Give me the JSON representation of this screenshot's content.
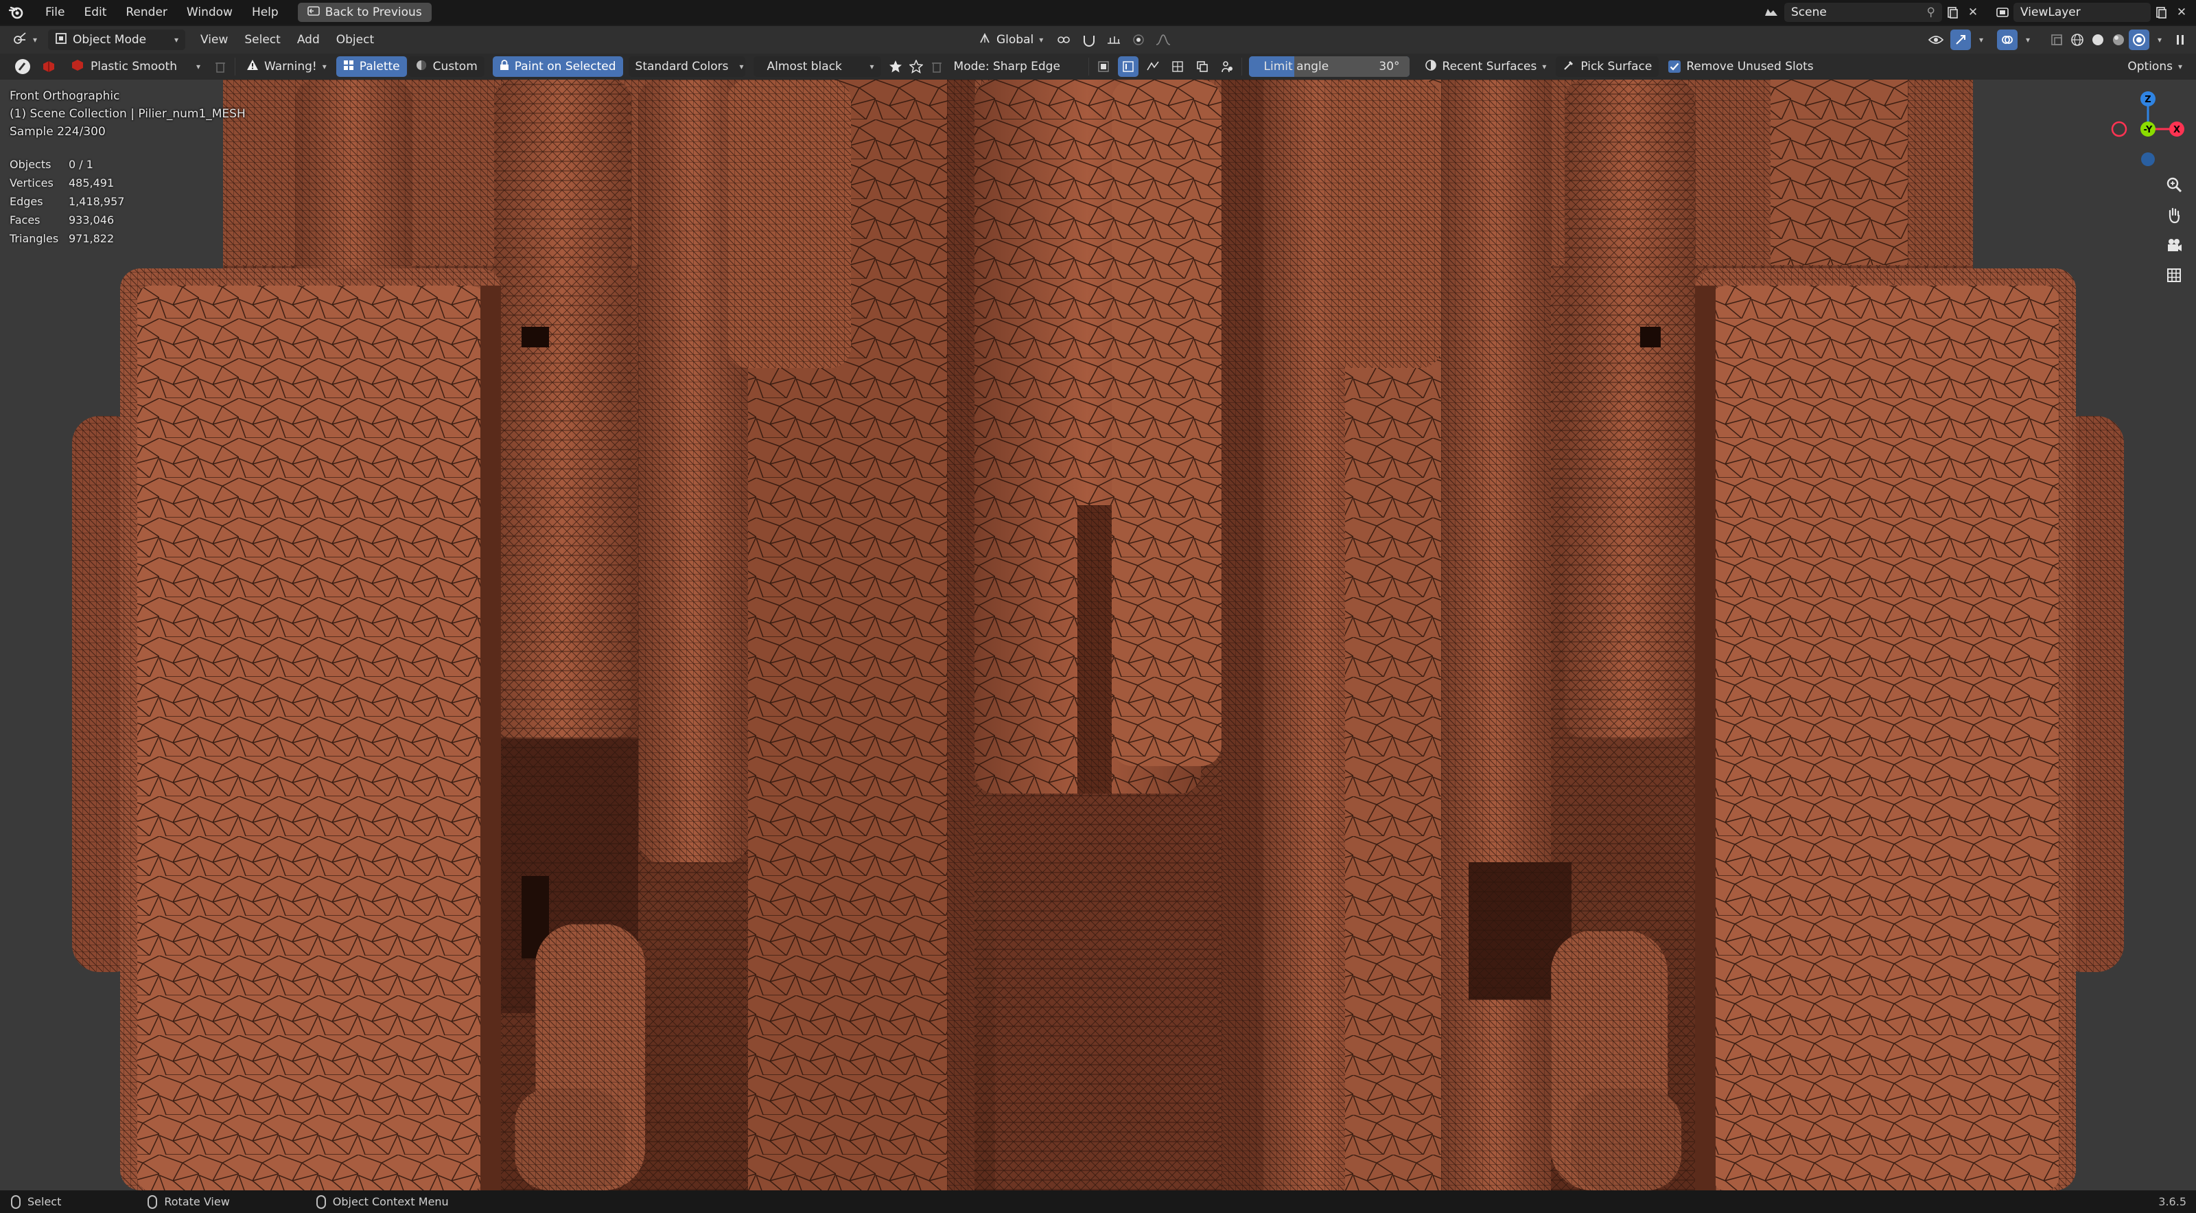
{
  "topbar": {
    "menus": [
      "File",
      "Edit",
      "Render",
      "Window",
      "Help"
    ],
    "back_label": "Back to Previous",
    "scene": "Scene",
    "view_layer": "ViewLayer"
  },
  "header": {
    "mode": "Object Mode",
    "menus": [
      "View",
      "Select",
      "Add",
      "Object"
    ],
    "transform_orientation": "Global"
  },
  "tool": {
    "brush": "Plastic Smooth",
    "warning": "Warning!",
    "palette": "Palette",
    "custom": "Custom",
    "paint_on_selected": "Paint on Selected",
    "color_set": "Standard Colors",
    "color": "Almost black",
    "mode": "Mode: Sharp Edge",
    "limit_angle_label": "Limit angle",
    "limit_angle_value": "30°",
    "recent_surfaces": "Recent Surfaces",
    "pick_surface": "Pick Surface",
    "remove_unused": "Remove Unused Slots",
    "options": "Options"
  },
  "viewport": {
    "view_name": "Front Orthographic",
    "collection": "(1) Scene Collection | Pilier_num1_MESH",
    "sample": "Sample 224/300",
    "stats": [
      {
        "k": "Objects",
        "v": "0 / 1"
      },
      {
        "k": "Vertices",
        "v": "485,491"
      },
      {
        "k": "Edges",
        "v": "1,418,957"
      },
      {
        "k": "Faces",
        "v": "933,046"
      },
      {
        "k": "Triangles",
        "v": "971,822"
      }
    ],
    "gizmo": {
      "z": "Z",
      "y": "-Y",
      "x": "X"
    }
  },
  "colors": {
    "mesh_base": "#9a5339",
    "mesh_light": "#b7674a",
    "mesh_dark": "#6a3422",
    "wire": "#2a140c",
    "accent": "#4772b3"
  },
  "statusbar": {
    "select": "Select",
    "rotate": "Rotate View",
    "context": "Object Context Menu",
    "version": "3.6.5"
  }
}
